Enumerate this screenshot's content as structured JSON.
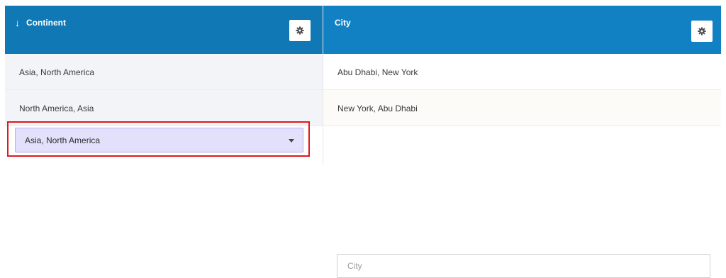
{
  "columns": [
    {
      "header": "Continent",
      "sort_icon": "arrow-down-icon",
      "settings_icon": "gear-icon",
      "rows": [
        "Asia, North America",
        "North America, Asia"
      ],
      "filter": {
        "type": "select",
        "selected": "Asia, North America"
      }
    },
    {
      "header": "City",
      "settings_icon": "gear-icon",
      "rows": [
        "Abu Dhabi, New York",
        "New York, Abu Dhabi"
      ],
      "filter": {
        "type": "input",
        "value": "",
        "placeholder": "City"
      }
    }
  ],
  "colors": {
    "header_bg": "#0f78b5",
    "header_bg_alt": "#1181c4",
    "selected_filter_bg": "#e3e0fb",
    "highlight_border": "#e0181c"
  }
}
